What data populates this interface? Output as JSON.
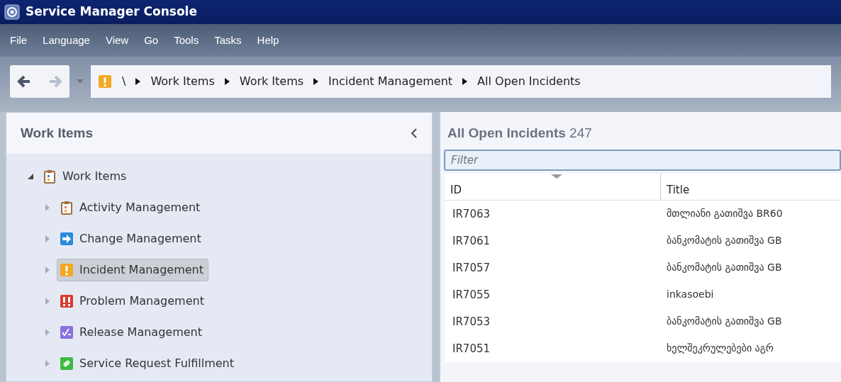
{
  "window": {
    "title": "Service Manager Console"
  },
  "menu": [
    "File",
    "Language",
    "View",
    "Go",
    "Tools",
    "Tasks",
    "Help"
  ],
  "nav": {
    "back_enabled": true,
    "forward_enabled": false
  },
  "breadcrumb": [
    "\\",
    "Work Items",
    "Work Items",
    "Incident Management",
    "All Open Incidents"
  ],
  "sidebar": {
    "title": "Work Items",
    "tree": [
      {
        "label": "Work Items",
        "kind": "work-items",
        "expanded": true,
        "selected": false,
        "children": [
          {
            "label": "Activity Management",
            "kind": "activity",
            "expanded": false,
            "selected": false
          },
          {
            "label": "Change Management",
            "kind": "change",
            "expanded": false,
            "selected": false
          },
          {
            "label": "Incident Management",
            "kind": "incident",
            "expanded": false,
            "selected": true
          },
          {
            "label": "Problem Management",
            "kind": "problem",
            "expanded": false,
            "selected": false
          },
          {
            "label": "Release Management",
            "kind": "release",
            "expanded": false,
            "selected": false
          },
          {
            "label": "Service Request Fulfillment",
            "kind": "service-request",
            "expanded": false,
            "selected": false
          }
        ]
      }
    ]
  },
  "view": {
    "title": "All Open Incidents",
    "count": "247",
    "filter": {
      "placeholder": "Filter"
    },
    "table": {
      "columns": [
        {
          "label": "ID",
          "sorted": true
        },
        {
          "label": "Title",
          "sorted": false
        }
      ],
      "rows": [
        {
          "id": "IR7063",
          "title": "მთლიანი გათიშვა BR60"
        },
        {
          "id": "IR7061",
          "title": "ბანკომატის გათიშვა GB"
        },
        {
          "id": "IR7057",
          "title": "ბანკომატის გათიშვა GB"
        },
        {
          "id": "IR7055",
          "title": "inkasoebi"
        },
        {
          "id": "IR7053",
          "title": "ბანკომატის გათიშვა GB"
        },
        {
          "id": "IR7051",
          "title": "ხელშეკრულებები აგრ"
        }
      ]
    }
  }
}
